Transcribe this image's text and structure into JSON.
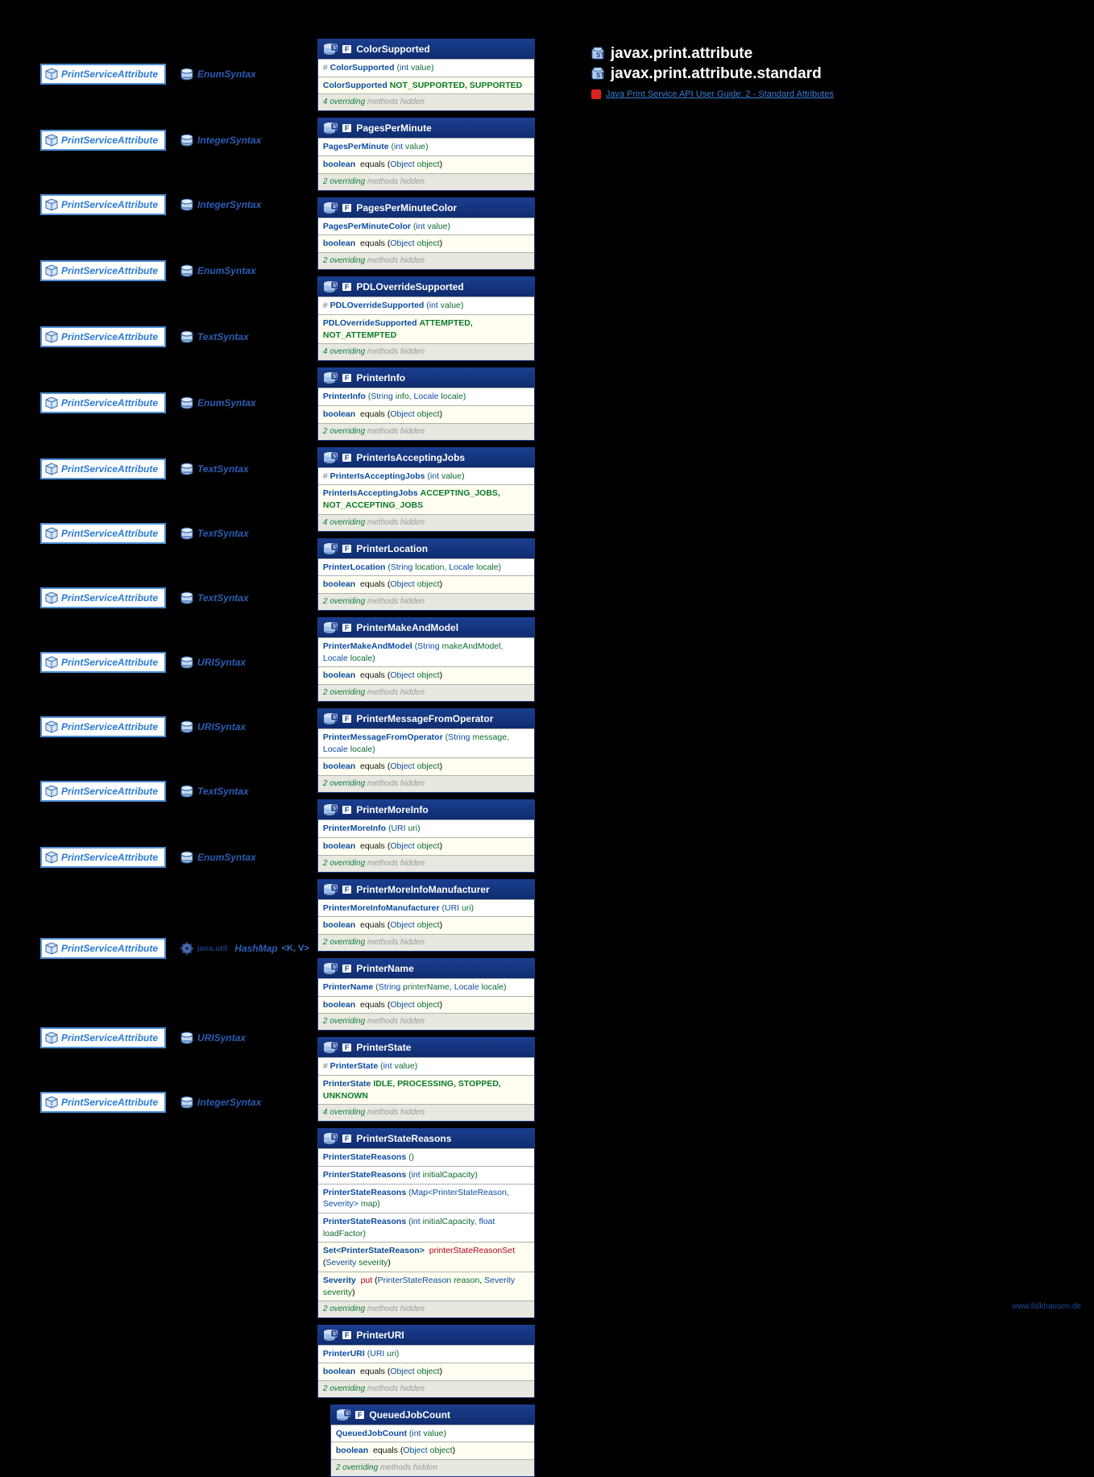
{
  "packages": [
    "javax.print.attribute",
    "javax.print.attribute.standard"
  ],
  "reference_link": "Java Print Service API User Guide: 2 - Standard Attributes",
  "watermark": "www.falkhausen.de",
  "psa_label": "PrintServiceAttribute",
  "syntax_labels": {
    "enum": "EnumSyntax",
    "integer": "IntegerSyntax",
    "text": "TextSyntax",
    "uri": "URISyntax",
    "hashmap_prefix": "java.util",
    "hashmap": "HashMap",
    "hashmap_generic": "<K, V>"
  },
  "rows": [
    {
      "syntax": "enum",
      "card_index": 0
    },
    {
      "syntax": "integer",
      "card_index": 1
    },
    {
      "syntax": "integer",
      "card_index": 2
    },
    {
      "syntax": "enum",
      "card_index": 3
    },
    {
      "syntax": "text",
      "card_index": 4
    },
    {
      "syntax": "enum",
      "card_index": 5
    },
    {
      "syntax": "text",
      "card_index": 6
    },
    {
      "syntax": "text",
      "card_index": 7
    },
    {
      "syntax": "text",
      "card_index": 8
    },
    {
      "syntax": "uri",
      "card_index": 9
    },
    {
      "syntax": "uri",
      "card_index": 10
    },
    {
      "syntax": "text",
      "card_index": 11
    },
    {
      "syntax": "enum",
      "card_index": 12
    },
    {
      "syntax": "hashmap",
      "card_index": 13
    },
    {
      "syntax": "uri",
      "card_index": 14
    },
    {
      "syntax": "integer",
      "card_index": 15
    }
  ],
  "cards": [
    {
      "title": "ColorSupported",
      "indented": false,
      "lines": [
        {
          "type": "ctor",
          "hash": true,
          "name": "ColorSupported",
          "args": "(int value)"
        },
        {
          "type": "const",
          "cls": "ColorSupported",
          "vals": "NOT_SUPPORTED, SUPPORTED"
        },
        {
          "type": "hidden",
          "count": "4",
          "text": "overriding methods hidden"
        }
      ]
    },
    {
      "title": "PagesPerMinute",
      "indented": false,
      "lines": [
        {
          "type": "ctor",
          "name": "PagesPerMinute",
          "args": "(int value)"
        },
        {
          "type": "method",
          "ret": "boolean",
          "name": "equals",
          "args": "(Object object)"
        },
        {
          "type": "hidden",
          "count": "2",
          "text": "overriding methods hidden"
        }
      ]
    },
    {
      "title": "PagesPerMinuteColor",
      "indented": false,
      "lines": [
        {
          "type": "ctor",
          "name": "PagesPerMinuteColor",
          "args": "(int value)"
        },
        {
          "type": "method",
          "ret": "boolean",
          "name": "equals",
          "args": "(Object object)"
        },
        {
          "type": "hidden",
          "count": "2",
          "text": "overriding methods hidden"
        }
      ]
    },
    {
      "title": "PDLOverrideSupported",
      "indented": false,
      "lines": [
        {
          "type": "ctor",
          "hash": true,
          "name": "PDLOverrideSupported",
          "args": "(int value)"
        },
        {
          "type": "const",
          "cls": "PDLOverrideSupported",
          "vals": "ATTEMPTED, NOT_ATTEMPTED"
        },
        {
          "type": "hidden",
          "count": "4",
          "text": "overriding methods hidden"
        }
      ]
    },
    {
      "title": "PrinterInfo",
      "indented": false,
      "lines": [
        {
          "type": "ctor",
          "name": "PrinterInfo",
          "args": "(String info, Locale locale)"
        },
        {
          "type": "method",
          "ret": "boolean",
          "name": "equals",
          "args": "(Object object)"
        },
        {
          "type": "hidden",
          "count": "2",
          "text": "overriding methods hidden"
        }
      ]
    },
    {
      "title": "PrinterIsAcceptingJobs",
      "indented": false,
      "lines": [
        {
          "type": "ctor",
          "hash": true,
          "name": "PrinterIsAcceptingJobs",
          "args": "(int value)"
        },
        {
          "type": "const",
          "cls": "PrinterIsAcceptingJobs",
          "vals": "ACCEPTING_JOBS, NOT_ACCEPTING_JOBS"
        },
        {
          "type": "hidden",
          "count": "4",
          "text": "overriding methods hidden"
        }
      ]
    },
    {
      "title": "PrinterLocation",
      "indented": false,
      "lines": [
        {
          "type": "ctor",
          "name": "PrinterLocation",
          "args": "(String location, Locale locale)"
        },
        {
          "type": "method",
          "ret": "boolean",
          "name": "equals",
          "args": "(Object object)"
        },
        {
          "type": "hidden",
          "count": "2",
          "text": "overriding methods hidden"
        }
      ]
    },
    {
      "title": "PrinterMakeAndModel",
      "indented": false,
      "lines": [
        {
          "type": "ctor",
          "name": "PrinterMakeAndModel",
          "args": "(String makeAndModel, Locale locale)"
        },
        {
          "type": "method",
          "ret": "boolean",
          "name": "equals",
          "args": "(Object object)"
        },
        {
          "type": "hidden",
          "count": "2",
          "text": "overriding methods hidden"
        }
      ]
    },
    {
      "title": "PrinterMessageFromOperator",
      "indented": false,
      "lines": [
        {
          "type": "ctor",
          "name": "PrinterMessageFromOperator",
          "args": "(String message, Locale locale)"
        },
        {
          "type": "method",
          "ret": "boolean",
          "name": "equals",
          "args": "(Object object)"
        },
        {
          "type": "hidden",
          "count": "2",
          "text": "overriding methods hidden"
        }
      ]
    },
    {
      "title": "PrinterMoreInfo",
      "indented": false,
      "lines": [
        {
          "type": "ctor",
          "name": "PrinterMoreInfo",
          "args": "(URI uri)"
        },
        {
          "type": "method",
          "ret": "boolean",
          "name": "equals",
          "args": "(Object object)"
        },
        {
          "type": "hidden",
          "count": "2",
          "text": "overriding methods hidden"
        }
      ]
    },
    {
      "title": "PrinterMoreInfoManufacturer",
      "indented": false,
      "lines": [
        {
          "type": "ctor",
          "name": "PrinterMoreInfoManufacturer",
          "args": "(URI uri)"
        },
        {
          "type": "method",
          "ret": "boolean",
          "name": "equals",
          "args": "(Object object)"
        },
        {
          "type": "hidden",
          "count": "2",
          "text": "overriding methods hidden"
        }
      ]
    },
    {
      "title": "PrinterName",
      "indented": false,
      "lines": [
        {
          "type": "ctor",
          "name": "PrinterName",
          "args": "(String printerName, Locale locale)"
        },
        {
          "type": "method",
          "ret": "boolean",
          "name": "equals",
          "args": "(Object object)"
        },
        {
          "type": "hidden",
          "count": "2",
          "text": "overriding methods hidden"
        }
      ]
    },
    {
      "title": "PrinterState",
      "indented": false,
      "lines": [
        {
          "type": "ctor",
          "hash": true,
          "name": "PrinterState",
          "args": "(int value)"
        },
        {
          "type": "const",
          "cls": "PrinterState",
          "vals": "IDLE, PROCESSING, STOPPED, UNKNOWN"
        },
        {
          "type": "hidden",
          "count": "4",
          "text": "overriding methods hidden"
        }
      ]
    },
    {
      "title": "PrinterStateReasons",
      "indented": false,
      "tall": true,
      "lines": [
        {
          "type": "ctor",
          "name": "PrinterStateReasons",
          "args": "()"
        },
        {
          "type": "ctor",
          "name": "PrinterStateReasons",
          "args": "(int initialCapacity)"
        },
        {
          "type": "ctor",
          "name": "PrinterStateReasons",
          "args": "(Map<PrinterStateReason, Severity> map)"
        },
        {
          "type": "ctor",
          "name": "PrinterStateReasons",
          "args": "(int initialCapacity, float loadFactor)"
        },
        {
          "type": "method",
          "ret": "Set<PrinterStateReason>",
          "name": "printerStateReasonSet",
          "red": true,
          "args": "(Severity severity)"
        },
        {
          "type": "method",
          "ret": "Severity",
          "name": "put",
          "red": true,
          "args": "(PrinterStateReason reason, Severity severity)"
        },
        {
          "type": "hidden",
          "count": "2",
          "text": "overriding methods hidden"
        }
      ]
    },
    {
      "title": "PrinterURI",
      "indented": false,
      "lines": [
        {
          "type": "ctor",
          "name": "PrinterURI",
          "args": "(URI uri)"
        },
        {
          "type": "method",
          "ret": "boolean",
          "name": "equals",
          "args": "(Object object)"
        },
        {
          "type": "hidden",
          "count": "2",
          "text": "overriding methods hidden"
        }
      ]
    },
    {
      "title": "QueuedJobCount",
      "indented": true,
      "lines": [
        {
          "type": "ctor",
          "name": "QueuedJobCount",
          "args": "(int value)"
        },
        {
          "type": "method",
          "ret": "boolean",
          "name": "equals",
          "args": "(Object object)"
        },
        {
          "type": "hidden",
          "count": "2",
          "text": "overriding methods hidden"
        }
      ]
    }
  ]
}
